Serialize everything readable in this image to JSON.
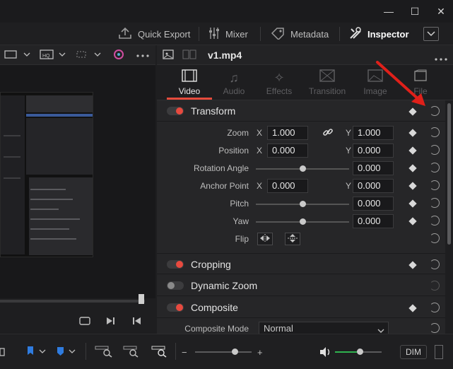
{
  "window": {
    "minimize_glyph": "—",
    "maximize_glyph": "☐",
    "close_glyph": "✕"
  },
  "toolbar": {
    "quick_export": "Quick Export",
    "mixer": "Mixer",
    "metadata": "Metadata",
    "inspector": "Inspector"
  },
  "inspector": {
    "filename": "v1.mp4",
    "tabs": [
      {
        "label": "Video",
        "icon": "film-icon",
        "active": true
      },
      {
        "label": "Audio",
        "icon": "music-note-icon",
        "active": false
      },
      {
        "label": "Effects",
        "icon": "magic-wand-icon",
        "active": false
      },
      {
        "label": "Transition",
        "icon": "transition-icon",
        "active": false
      },
      {
        "label": "Image",
        "icon": "image-icon",
        "active": false
      },
      {
        "label": "File",
        "icon": "file-icon",
        "active": false
      }
    ],
    "transform": {
      "title": "Transform",
      "zoom_label": "Zoom",
      "zoom_x": "1.000",
      "zoom_y": "1.000",
      "position_label": "Position",
      "position_x": "0.000",
      "position_y": "0.000",
      "rotation_label": "Rotation Angle",
      "rotation_value": "0.000",
      "anchor_label": "Anchor Point",
      "anchor_x": "0.000",
      "anchor_y": "0.000",
      "pitch_label": "Pitch",
      "pitch_value": "0.000",
      "yaw_label": "Yaw",
      "yaw_value": "0.000",
      "flip_label": "Flip",
      "x_axis": "X",
      "y_axis": "Y"
    },
    "cropping": {
      "title": "Cropping"
    },
    "dynamic_zoom": {
      "title": "Dynamic Zoom"
    },
    "composite": {
      "title": "Composite",
      "mode_label": "Composite Mode",
      "mode_value": "Normal"
    }
  },
  "bottom": {
    "dim_label": "DIM"
  },
  "colors": {
    "accent": "#e84a3f",
    "volume": "#2fb34f",
    "arrow": "#e0201a"
  }
}
